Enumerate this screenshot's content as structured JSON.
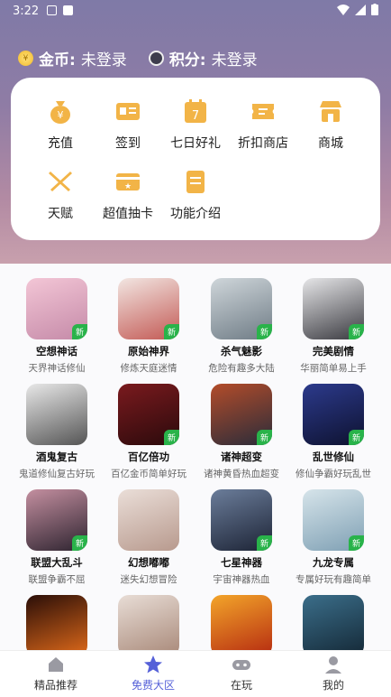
{
  "status_bar": {
    "time": "3:22"
  },
  "header": {
    "coins_label": "金币:",
    "coins_value": "未登录",
    "points_label": "积分:",
    "points_value": "未登录"
  },
  "menu": [
    {
      "label": "充值",
      "icon": "money-bag-icon"
    },
    {
      "label": "签到",
      "icon": "id-card-icon"
    },
    {
      "label": "七日好礼",
      "icon": "calendar-7-icon"
    },
    {
      "label": "折扣商店",
      "icon": "coupon-icon"
    },
    {
      "label": "商城",
      "icon": "store-icon"
    },
    {
      "label": "天赋",
      "icon": "crossed-swords-icon"
    },
    {
      "label": "超值抽卡",
      "icon": "card-star-icon"
    },
    {
      "label": "功能介绍",
      "icon": "document-icon"
    }
  ],
  "games": [
    {
      "name": "空想神话",
      "desc": "天界神话修仙",
      "tag": "新",
      "colors": [
        "#f3c6d6",
        "#c58aa8"
      ]
    },
    {
      "name": "原始神界",
      "desc": "修炼天庭迷情",
      "tag": "新",
      "colors": [
        "#f2e6e2",
        "#c35a55"
      ]
    },
    {
      "name": "杀气魅影",
      "desc": "危险有趣多大陆",
      "tag": "新",
      "colors": [
        "#cfd6da",
        "#6f7c86"
      ]
    },
    {
      "name": "完美剧情",
      "desc": "华丽简单易上手",
      "tag": "新",
      "colors": [
        "#e6e6e8",
        "#3a3a40"
      ]
    },
    {
      "name": "酒鬼复古",
      "desc": "鬼道修仙复古好玩",
      "tag": "",
      "colors": [
        "#e8e8e8",
        "#555555"
      ]
    },
    {
      "name": "百亿倍功",
      "desc": "百亿金币简单好玩",
      "tag": "新",
      "colors": [
        "#7a1a1e",
        "#2b0a0c"
      ]
    },
    {
      "name": "诸神超变",
      "desc": "诸神黄昏热血超变",
      "tag": "新",
      "colors": [
        "#b34c2a",
        "#2a2c3a"
      ]
    },
    {
      "name": "乱世修仙",
      "desc": "修仙争霸好玩乱世",
      "tag": "新",
      "colors": [
        "#2c3a8c",
        "#0e1230"
      ]
    },
    {
      "name": "联盟大乱斗",
      "desc": "联盟争霸不屈",
      "tag": "新",
      "colors": [
        "#c48fa0",
        "#2e2430"
      ]
    },
    {
      "name": "幻想嘟嘟",
      "desc": "迷失幻想冒险",
      "tag": "",
      "colors": [
        "#eaded8",
        "#b89a8e"
      ]
    },
    {
      "name": "七星神器",
      "desc": "宇宙神器热血",
      "tag": "新",
      "colors": [
        "#6b7d9a",
        "#1d2436"
      ]
    },
    {
      "name": "九龙专属",
      "desc": "专属好玩有趣简单",
      "tag": "新",
      "colors": [
        "#d6e4ea",
        "#7fa0b4"
      ]
    },
    {
      "name": "",
      "desc": "",
      "tag": "",
      "colors": [
        "#2a0e08",
        "#e06a1a"
      ]
    },
    {
      "name": "",
      "desc": "",
      "tag": "",
      "colors": [
        "#e8ddd6",
        "#a88878"
      ]
    },
    {
      "name": "",
      "desc": "",
      "tag": "",
      "colors": [
        "#f3a52a",
        "#b52a10"
      ]
    },
    {
      "name": "",
      "desc": "",
      "tag": "",
      "colors": [
        "#3b6e8a",
        "#142836"
      ]
    }
  ],
  "tabs": [
    {
      "label": "精品推荐",
      "icon": "home-icon",
      "active": false
    },
    {
      "label": "免费大区",
      "icon": "star-icon",
      "active": true
    },
    {
      "label": "在玩",
      "icon": "gamepad-icon",
      "active": false
    },
    {
      "label": "我的",
      "icon": "user-icon",
      "active": false
    }
  ],
  "colors": {
    "accent": "#5560d8",
    "new_badge": "#29b34a",
    "menu_icon": "#f2b447"
  }
}
